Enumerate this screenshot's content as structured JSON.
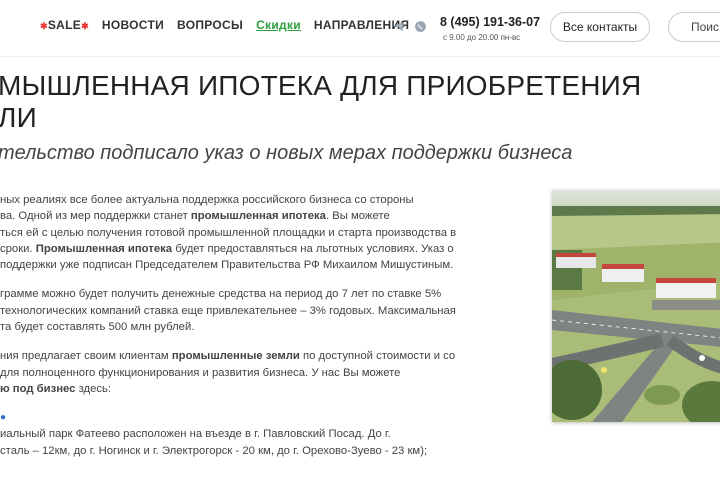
{
  "nav": {
    "sale": "SALE",
    "items": [
      "НОВОСТИ",
      "ВОПРОСЫ",
      "Скидки",
      "НАПРАВЛЕНИЯ"
    ]
  },
  "contact": {
    "phone": "8 (495) 191-36-07",
    "hours": "с 9.00 до 20.00 пн-вс",
    "all_contacts": "Все контакты",
    "search": "Поис"
  },
  "article": {
    "title_line1": "МЫШЛЕННАЯ ИПОТЕКА ДЛЯ ПРИОБРЕТЕНИЯ",
    "title_line2": "ЛИ",
    "subtitle": "тельство подписало указ о новых мерах поддержки бизнеса",
    "p1_a": "ных реалиях все более актуальна поддержка российского бизнеса со стороны",
    "p1_b": "ва. Одной из мер поддержки станет ",
    "p1_b_strong": "промышленная ипотека",
    "p1_b_end": ". Вы можете",
    "p1_c": "ться ей с целью получения готовой промышленной площадки и старта производства в",
    "p1_d": "сроки. ",
    "p1_d_strong": "Промышленная ипотека",
    "p1_d_end": " будет предоставляться на льготных условиях. Указ о",
    "p1_e": "поддержки уже подписан Председателем Правительства РФ Михаилом Мишустиным.",
    "p2_a": "грамме можно будет получить денежные средства на период до 7 лет по ставке 5%",
    "p2_b": "технологических компаний ставка еще привлекательнее – 3% годовых. Максимальная",
    "p2_c": "та будет составлять 500 млн рублей.",
    "p3_a": "ния предлагает своим клиентам ",
    "p3_a_strong": "промышленные земли",
    "p3_a_end": " по доступной стоимости и со",
    "p3_b": "для полноценного функционирования и развития бизнеса. У нас Вы можете",
    "p3_c_strong": "ю под бизнес",
    "p3_c_end": " здесь:",
    "p4_a": "иальный парк Фатеево расположен на въезде в г. Павловский Посад. До г.",
    "p4_b": "сталь – 12км, до г. Ногинск и г. Электрогорск - 20 км, до г. Орехово-Зуево - 23 км);"
  },
  "colors": {
    "accent_green": "#2e9e3e",
    "sale_star": "#e53935",
    "bullet_blue": "#2f6fc9"
  },
  "icons": [
    "telegram-icon",
    "whatsapp-icon",
    "search-icon"
  ]
}
